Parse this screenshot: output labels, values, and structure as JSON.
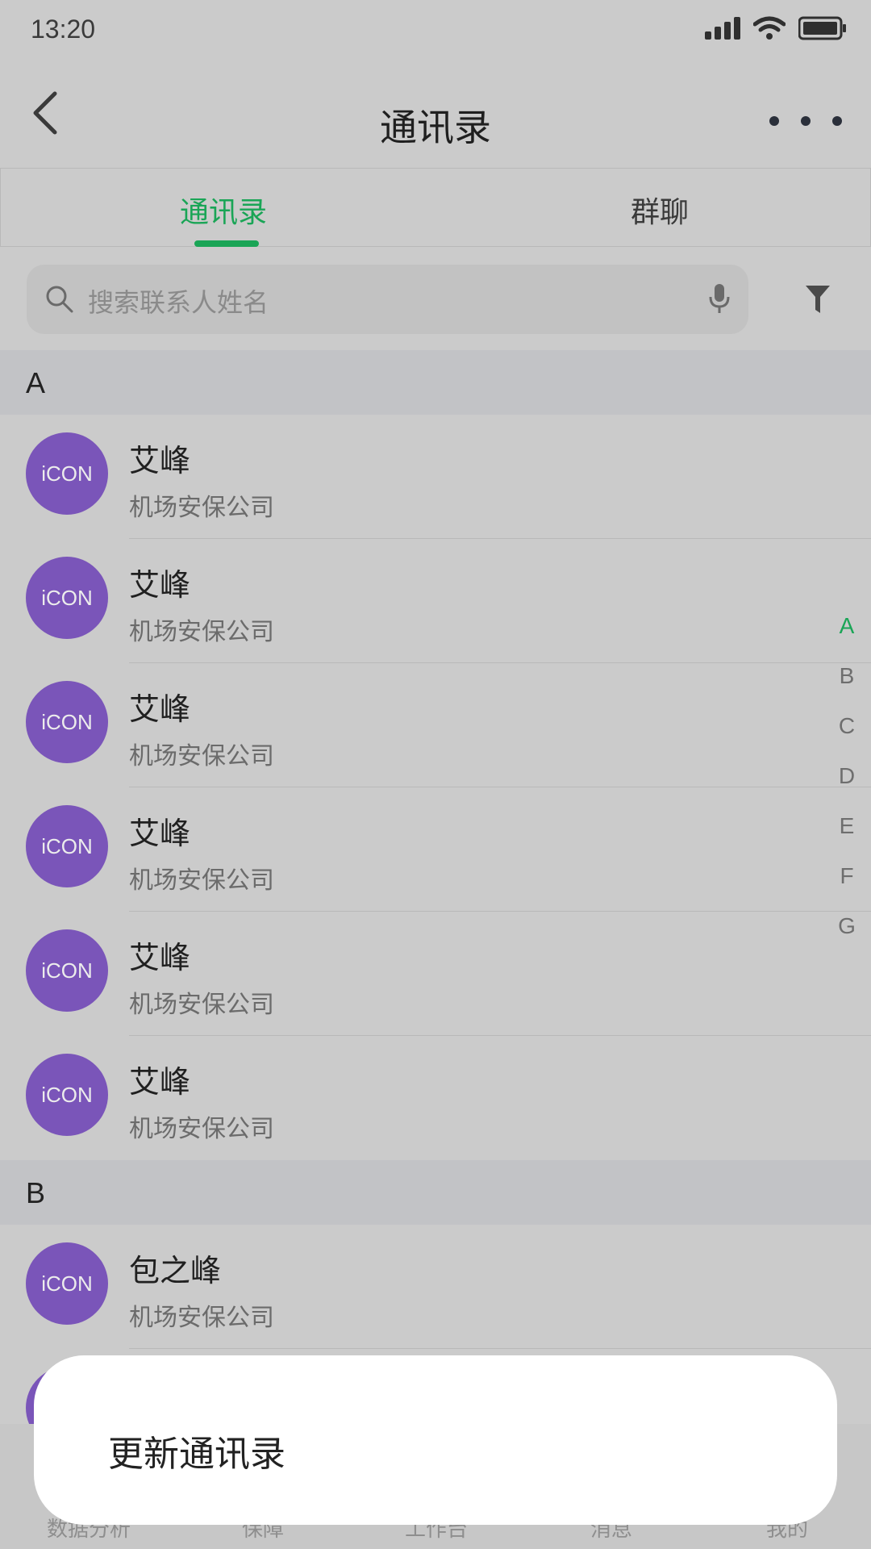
{
  "status": {
    "time": "13:20"
  },
  "nav": {
    "title": "通讯录"
  },
  "tabs": [
    {
      "label": "通讯录",
      "active": true
    },
    {
      "label": "群聊",
      "active": false
    }
  ],
  "search": {
    "placeholder": "搜索联系人姓名"
  },
  "sections": [
    {
      "letter": "A",
      "contacts": [
        {
          "avatar": "iCON",
          "name": "艾峰",
          "company": "机场安保公司"
        },
        {
          "avatar": "iCON",
          "name": "艾峰",
          "company": "机场安保公司"
        },
        {
          "avatar": "iCON",
          "name": "艾峰",
          "company": "机场安保公司"
        },
        {
          "avatar": "iCON",
          "name": "艾峰",
          "company": "机场安保公司"
        },
        {
          "avatar": "iCON",
          "name": "艾峰",
          "company": "机场安保公司"
        },
        {
          "avatar": "iCON",
          "name": "艾峰",
          "company": "机场安保公司"
        }
      ]
    },
    {
      "letter": "B",
      "contacts": [
        {
          "avatar": "iCON",
          "name": "包之峰",
          "company": "机场安保公司"
        }
      ]
    }
  ],
  "index_letters": [
    "A",
    "B",
    "C",
    "D",
    "E",
    "F",
    "G"
  ],
  "index_active": "A",
  "bottom_tabs": [
    "数据分析",
    "保障",
    "工作台",
    "消息",
    "我的"
  ],
  "popup": {
    "text": "更新通讯录"
  },
  "colors": {
    "accent": "#1aa556",
    "avatar": "#7a55b9",
    "background": "#cbcbcb"
  }
}
